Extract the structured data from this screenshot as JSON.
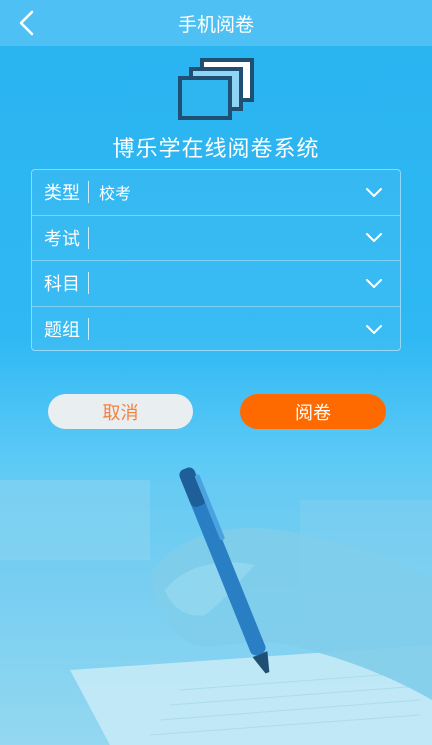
{
  "header": {
    "title": "手机阅卷",
    "back_icon": "chevron-left-icon"
  },
  "app": {
    "logo_icon": "stacked-papers-icon",
    "title": "博乐学在线阅卷系统"
  },
  "form": {
    "rows": [
      {
        "label": "类型",
        "value": "校考"
      },
      {
        "label": "考试",
        "value": ""
      },
      {
        "label": "科目",
        "value": ""
      },
      {
        "label": "题组",
        "value": ""
      }
    ]
  },
  "buttons": {
    "cancel": "取消",
    "review": "阅卷"
  },
  "colors": {
    "nav_bg": "#4fc0f3",
    "bg_top": "#29b3f0",
    "accent": "#ff6a00",
    "cancel_text": "#f4813e"
  }
}
